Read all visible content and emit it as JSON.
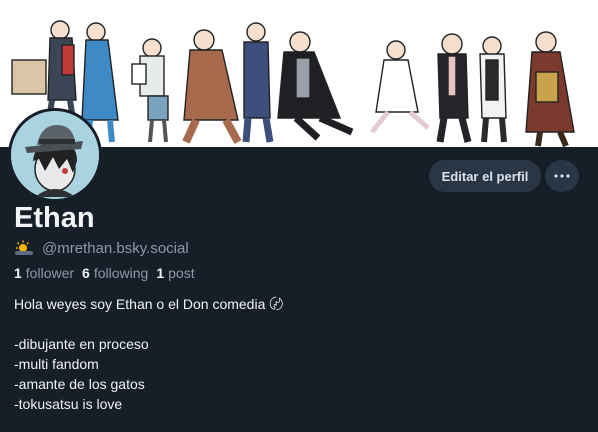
{
  "profile": {
    "display_name": "Ethan",
    "handle": "@mrethan.bsky.social",
    "handle_icon": "sun-cloud-icon",
    "stats": {
      "followers_count": "1",
      "followers_label": "follower",
      "following_count": "6",
      "following_label": "following",
      "posts_count": "1",
      "posts_label": "post"
    },
    "bio_lines": [
      "Hola weyes soy Ethan o el Don comedia 〄",
      "",
      "-dibujante en proceso",
      "-multi fandom",
      "-amante de los gatos",
      "-tokusatsu is love"
    ]
  },
  "actions": {
    "edit_label": "Editar el perfil",
    "more_icon": "ellipsis-icon"
  },
  "colors": {
    "background": "#161e27",
    "button_bg": "#2a3645",
    "muted_text": "#8b9aab",
    "avatar_bg": "#a9d3e1"
  }
}
